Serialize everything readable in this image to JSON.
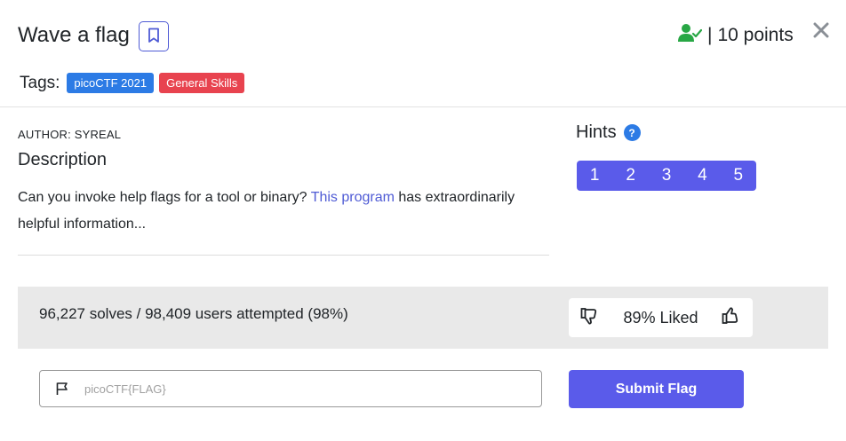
{
  "challenge": {
    "title": "Wave a flag",
    "points_separator": "|",
    "points": "10 points",
    "close_glyph": "✕"
  },
  "tags": {
    "label": "Tags:",
    "items": [
      {
        "label": "picoCTF 2021",
        "color": "#2c7be5"
      },
      {
        "label": "General Skills",
        "color": "#e8434f"
      }
    ]
  },
  "author": "AUTHOR: SYREAL",
  "description": {
    "heading": "Description",
    "text_before": "Can you invoke help flags for a tool or binary? ",
    "link_text": "This program",
    "text_after": " has extraordinarily helpful information..."
  },
  "hints": {
    "heading": "Hints",
    "help_glyph": "?",
    "items": [
      "1",
      "2",
      "3",
      "4",
      "5"
    ]
  },
  "stats": {
    "text": "96,227 solves / 98,409 users attempted (98%)",
    "liked_text": "89% Liked"
  },
  "flag_form": {
    "placeholder": "picoCTF{FLAG}",
    "value": "",
    "submit_label": "Submit Flag"
  },
  "colors": {
    "accent": "#5a5bea",
    "link": "#4f5bd5",
    "solved_green": "#28a745",
    "stats_bg": "#e9e9e9"
  },
  "icons": {
    "bookmark": "bookmark-icon",
    "solved_user": "user-check-icon",
    "close": "close-icon",
    "help": "help-circle-icon",
    "thumbs_down": "thumbs-down-icon",
    "thumbs_up": "thumbs-up-icon",
    "flag": "flag-icon"
  }
}
